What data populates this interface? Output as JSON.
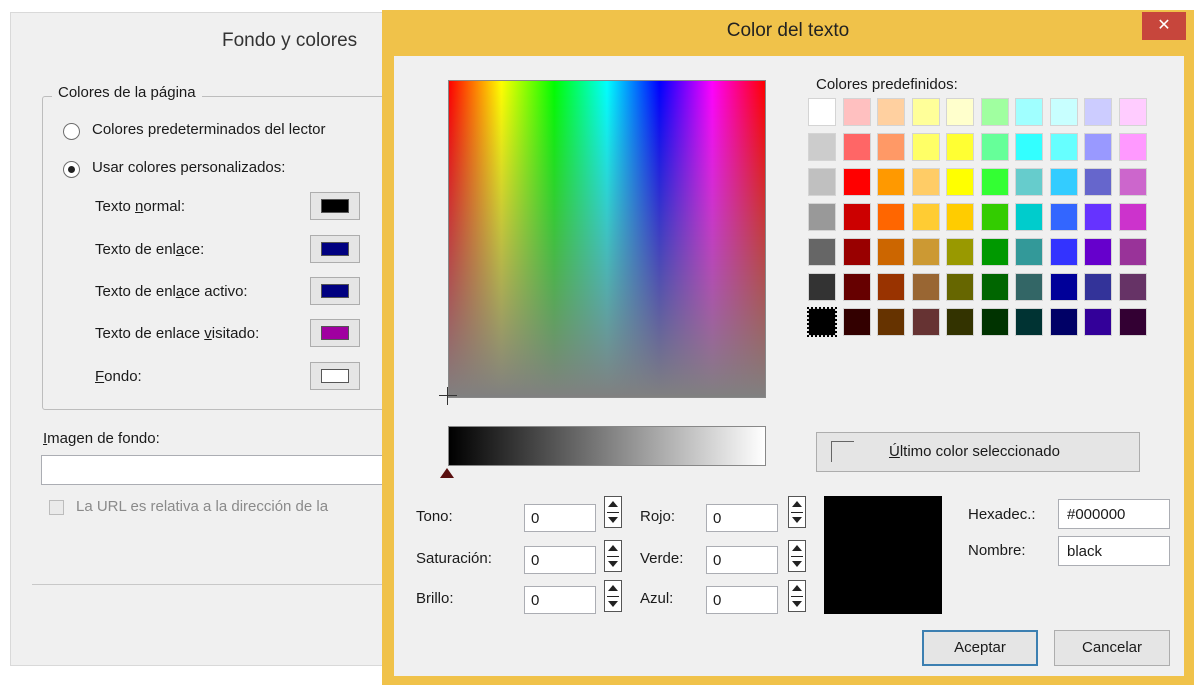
{
  "background_dialog": {
    "title": "Fondo y colores",
    "group_label": "Colores de la página",
    "radio_default": "Colores predeterminados del lector",
    "radio_custom": "Usar colores personalizados:",
    "rows": [
      {
        "pre": "Texto ",
        "ul": "n",
        "post": "ormal:",
        "color": "#000000"
      },
      {
        "pre": "Texto de enl",
        "ul": "a",
        "post": "ce:",
        "color": "#000080"
      },
      {
        "pre": "Texto de enl",
        "ul": "a",
        "post": "ce activo:",
        "color": "#000080"
      },
      {
        "pre": "Texto de enlace ",
        "ul": "v",
        "post": "isitado:",
        "color": "#a000a0"
      },
      {
        "pre": "",
        "ul": "F",
        "post": "ondo:",
        "color": "#ffffff"
      }
    ],
    "image_label": "Imagen de fondo:",
    "image_value": "",
    "relative_url_label": "La URL es relativa a la dirección de la"
  },
  "dialog": {
    "title": "Color del texto",
    "close_glyph": "✕",
    "predefined_label": "Colores predefinidos:",
    "palette": [
      [
        "#ffffff",
        "#ffc0c0",
        "#ffd0a0",
        "#ffff99",
        "#ffffcc",
        "#a0ffa0",
        "#a0ffff",
        "#c8ffff",
        "#ccccff",
        "#ffccff"
      ],
      [
        "#cccccc",
        "#ff6666",
        "#ff9966",
        "#ffff66",
        "#ffff33",
        "#66ff99",
        "#33ffff",
        "#66ffff",
        "#9999ff",
        "#ff99ff"
      ],
      [
        "#c0c0c0",
        "#ff0000",
        "#ff9900",
        "#ffcc66",
        "#ffff00",
        "#33ff33",
        "#66cccc",
        "#33ccff",
        "#6666cc",
        "#cc66cc"
      ],
      [
        "#999999",
        "#cc0000",
        "#ff6600",
        "#ffcc33",
        "#ffcc00",
        "#33cc00",
        "#00cccc",
        "#3366ff",
        "#6633ff",
        "#cc33cc"
      ],
      [
        "#666666",
        "#990000",
        "#cc6600",
        "#cc9933",
        "#999900",
        "#009900",
        "#339999",
        "#3333ff",
        "#6600cc",
        "#993399"
      ],
      [
        "#333333",
        "#660000",
        "#993300",
        "#996633",
        "#666600",
        "#006600",
        "#336666",
        "#000099",
        "#333399",
        "#663366"
      ],
      [
        "#000000",
        "#330000",
        "#663300",
        "#663333",
        "#333300",
        "#003300",
        "#003333",
        "#000066",
        "#330099",
        "#330033"
      ]
    ],
    "last_color_label": "Último color seleccionado",
    "tono_label": "Tono:",
    "tono": "0",
    "saturacion_label": "Saturación:",
    "saturacion": "0",
    "brillo_label": "Brillo:",
    "brillo": "0",
    "rojo_label": "Rojo:",
    "rojo": "0",
    "verde_label": "Verde:",
    "verde": "0",
    "azul_label": "Azul:",
    "azul": "0",
    "preview_color": "#000000",
    "hex_label": "Hexadec.:",
    "hex": "#000000",
    "name_label": "Nombre:",
    "name": "black",
    "accept": "Aceptar",
    "cancel": "Cancelar"
  }
}
